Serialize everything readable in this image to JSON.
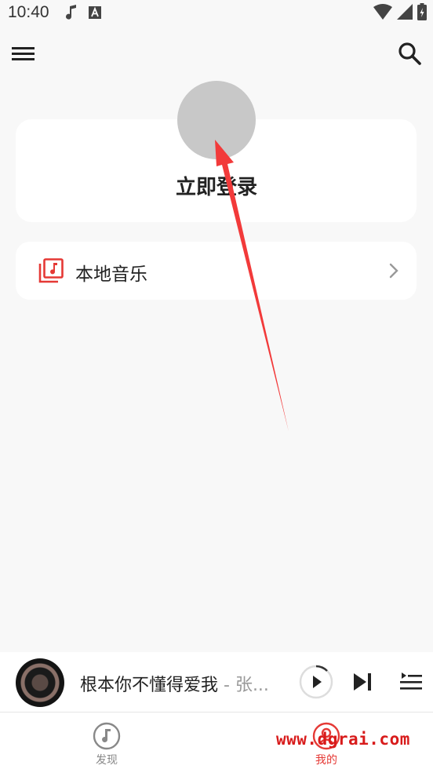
{
  "status_bar": {
    "time": "10:40"
  },
  "profile": {
    "login_label": "立即登录"
  },
  "local_music": {
    "label": "本地音乐"
  },
  "player": {
    "song": "根本你不懂得爱我",
    "artist": " - 张..."
  },
  "bottom_nav": {
    "discover": "发现",
    "mine": "我的"
  },
  "watermark": {
    "text": "www.dgrai.com"
  },
  "colors": {
    "accent": "#e53935",
    "background": "#f8f8f8",
    "card": "#ffffff",
    "annotation": "#f23a3a"
  },
  "icons": [
    "music-note-icon",
    "font-icon",
    "wifi-icon",
    "signal-icon",
    "battery-icon",
    "menu-icon",
    "search-icon",
    "music-library-icon",
    "chevron-right-icon",
    "play-icon",
    "skip-next-icon",
    "playlist-icon",
    "disc-icon",
    "user-icon"
  ]
}
